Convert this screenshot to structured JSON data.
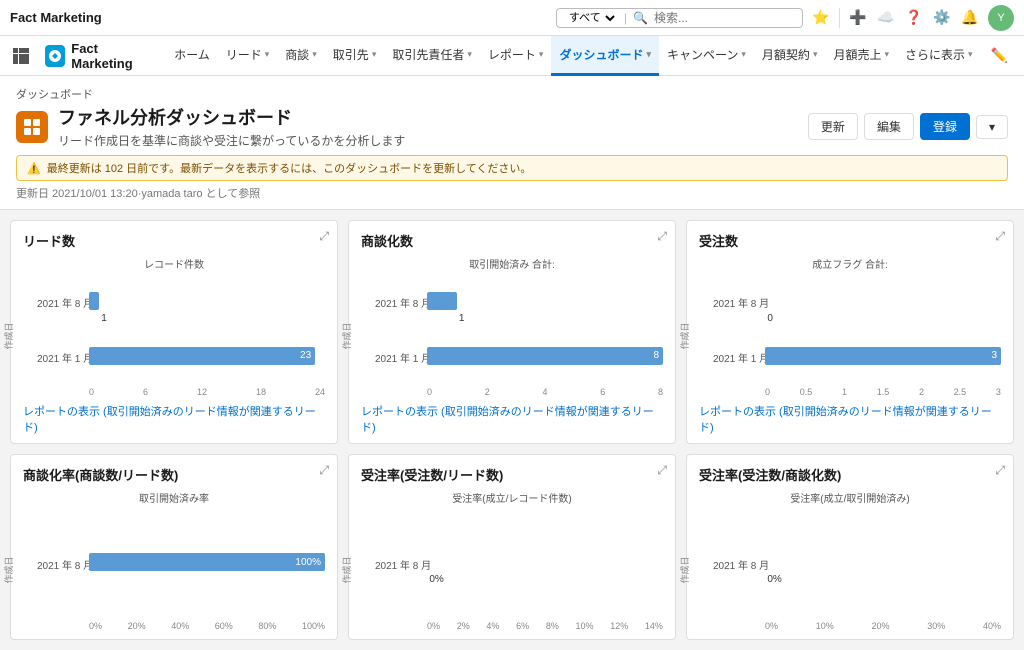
{
  "topbar": {
    "logo": "Fact Marketing",
    "search_placeholder": "検索...",
    "filter_option": "すべて",
    "icons": [
      "★",
      "＋",
      "☁",
      "?",
      "♪",
      "🔔"
    ]
  },
  "navbar": {
    "logo_text": "Fact Marketing",
    "items": [
      {
        "label": "ホーム",
        "has_chevron": false,
        "active": false
      },
      {
        "label": "リード",
        "has_chevron": true,
        "active": false
      },
      {
        "label": "商談",
        "has_chevron": true,
        "active": false
      },
      {
        "label": "取引先",
        "has_chevron": true,
        "active": false
      },
      {
        "label": "取引先責任者",
        "has_chevron": true,
        "active": false
      },
      {
        "label": "レポート",
        "has_chevron": true,
        "active": false
      },
      {
        "label": "ダッシュボード",
        "has_chevron": true,
        "active": true
      },
      {
        "label": "キャンペーン",
        "has_chevron": true,
        "active": false
      },
      {
        "label": "月額契約",
        "has_chevron": true,
        "active": false
      },
      {
        "label": "月額売上",
        "has_chevron": true,
        "active": false
      },
      {
        "label": "さらに表示",
        "has_chevron": true,
        "active": false
      }
    ]
  },
  "dashboard": {
    "breadcrumb": "ダッシュボード",
    "title": "ファネル分析ダッシュボード",
    "subtitle": "リード作成日を基準に商談や受注に繋がっているかを分析します",
    "warning": "最終更新は 102 日前です。最新データを表示するには、このダッシュボードを更新してください。",
    "meta": "更新日 2021/10/01 13:20·yamada taro として参照",
    "btn_update": "更新",
    "btn_edit": "編集",
    "btn_register": "登録"
  },
  "charts": [
    {
      "id": "lead-count",
      "title": "リード数",
      "subtitle": "レコード件数",
      "x_axis": [
        "0",
        "6",
        "12",
        "18",
        "24"
      ],
      "y_axis_label": "作成日",
      "bars": [
        {
          "label": "2021 年 8 月",
          "value": 1,
          "max": 24,
          "display": "1"
        },
        {
          "label": "2021 年 1 月",
          "value": 23,
          "max": 24,
          "display": "23"
        }
      ],
      "link": "レポートの表示 (取引開始済みのリード情報が関連するリード)"
    },
    {
      "id": "deal-count",
      "title": "商談化数",
      "subtitle": "取引開始済み 合計:",
      "x_axis": [
        "0",
        "2",
        "4",
        "6",
        "8"
      ],
      "y_axis_label": "作成日",
      "bars": [
        {
          "label": "2021 年 8 月",
          "value": 1,
          "max": 8,
          "display": "1"
        },
        {
          "label": "2021 年 1 月",
          "value": 8,
          "max": 8,
          "display": "8"
        }
      ],
      "link": "レポートの表示 (取引開始済みのリード情報が関連するリード)"
    },
    {
      "id": "order-count",
      "title": "受注数",
      "subtitle": "成立フラグ 合計:",
      "x_axis": [
        "0",
        "0.5",
        "1",
        "1.5",
        "2",
        "2.5",
        "3"
      ],
      "y_axis_label": "作成日",
      "bars": [
        {
          "label": "2021 年 8 月",
          "value": 0,
          "max": 3,
          "display": "0"
        },
        {
          "label": "2021 年 1 月",
          "value": 3,
          "max": 3,
          "display": "3"
        }
      ],
      "link": "レポートの表示 (取引開始済みのリード情報が関連するリード)"
    },
    {
      "id": "deal-rate",
      "title": "商談化率(商談数/リード数)",
      "subtitle": "取引開始済み率",
      "x_axis": [
        "0%",
        "20%",
        "40%",
        "60%",
        "80%",
        "100%"
      ],
      "y_axis_label": "作成日",
      "bars": [
        {
          "label": "2021 年 8 月",
          "value": 100,
          "max": 100,
          "display": "100%"
        }
      ],
      "link": ""
    },
    {
      "id": "order-rate-lead",
      "title": "受注率(受注数/リード数)",
      "subtitle": "受注率(成立/レコード件数)",
      "x_axis": [
        "0%",
        "2%",
        "4%",
        "6%",
        "8%",
        "10%",
        "12%",
        "14%"
      ],
      "y_axis_label": "作成日",
      "bars": [
        {
          "label": "2021 年 8 月",
          "value": 0,
          "max": 14,
          "display": "0%"
        }
      ],
      "link": ""
    },
    {
      "id": "order-rate-deal",
      "title": "受注率(受注数/商談化数)",
      "subtitle": "受注率(成立/取引開始済み)",
      "x_axis": [
        "0%",
        "10%",
        "20%",
        "30%",
        "40%"
      ],
      "y_axis_label": "作成日",
      "bars": [
        {
          "label": "2021 年 8 月",
          "value": 0,
          "max": 40,
          "display": "0%"
        }
      ],
      "link": ""
    }
  ]
}
